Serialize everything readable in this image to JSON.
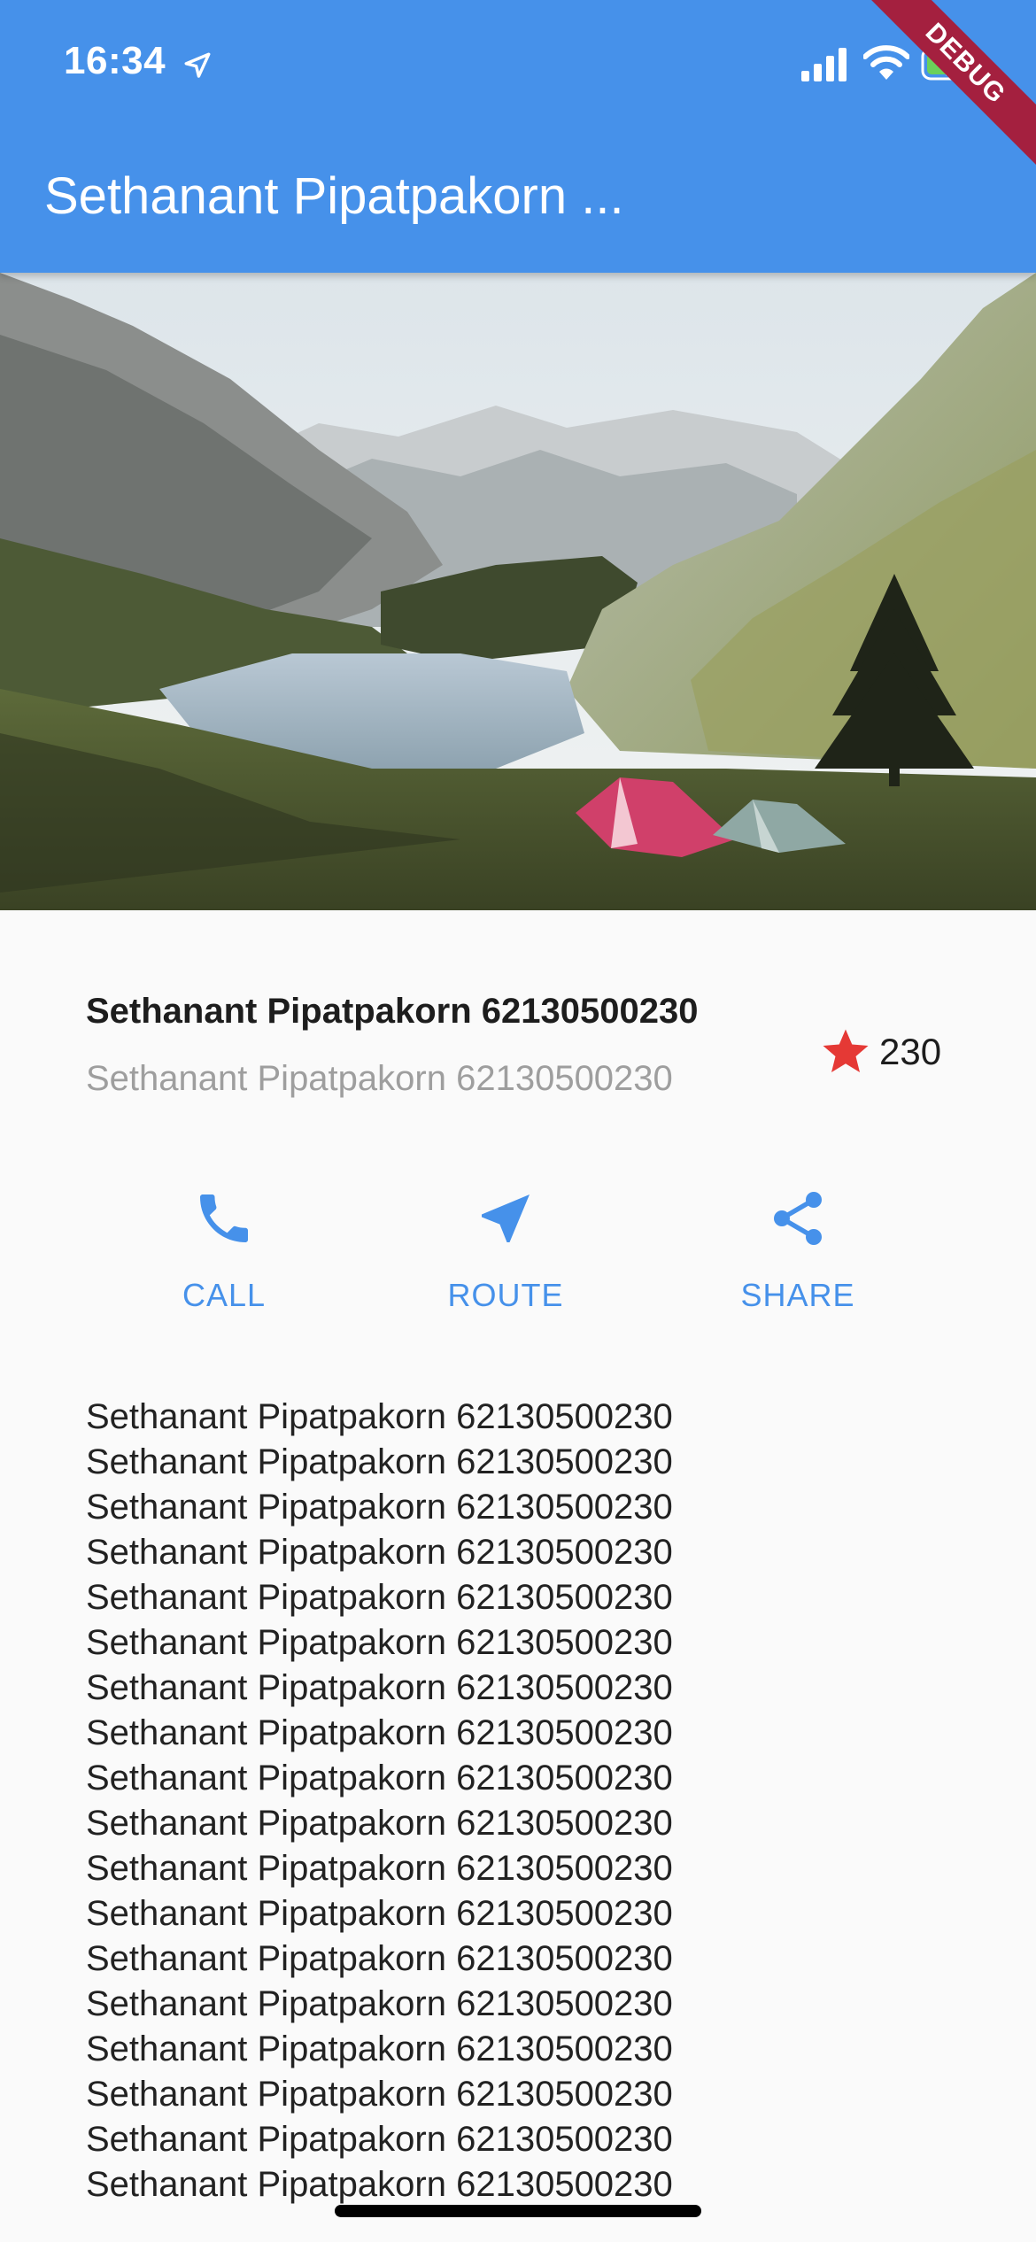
{
  "status_bar": {
    "time": "16:34",
    "icons": [
      "location-arrow-icon",
      "cellular-signal-icon",
      "wifi-icon",
      "battery-charging-icon"
    ]
  },
  "debug_banner": "DEBUG",
  "app_bar": {
    "title": "Sethanant Pipatpakorn ...",
    "background_color": "#4691ea"
  },
  "hero_image": {
    "subject": "mountain-lake-with-tents-photo"
  },
  "title_section": {
    "name": "Sethanant Pipatpakorn 62130500230",
    "subtitle": "Sethanant Pipatpakorn 62130500230",
    "star_icon": "star-icon",
    "star_color": "#e53935",
    "favorite_count": "230"
  },
  "actions": [
    {
      "label": "CALL",
      "icon": "phone-icon"
    },
    {
      "label": "ROUTE",
      "icon": "near-me-icon"
    },
    {
      "label": "SHARE",
      "icon": "share-icon"
    }
  ],
  "accent_color": "#4691ea",
  "description_lines": [
    "Sethanant Pipatpakorn 62130500230",
    "Sethanant Pipatpakorn 62130500230",
    "Sethanant Pipatpakorn 62130500230",
    "Sethanant Pipatpakorn 62130500230",
    "Sethanant Pipatpakorn 62130500230",
    "Sethanant Pipatpakorn 62130500230",
    "Sethanant Pipatpakorn 62130500230",
    "Sethanant Pipatpakorn 62130500230",
    "Sethanant Pipatpakorn 62130500230",
    "Sethanant Pipatpakorn 62130500230",
    "Sethanant Pipatpakorn 62130500230",
    "Sethanant Pipatpakorn 62130500230",
    "Sethanant Pipatpakorn 62130500230",
    "Sethanant Pipatpakorn 62130500230",
    "Sethanant Pipatpakorn 62130500230",
    "Sethanant Pipatpakorn 62130500230",
    "Sethanant Pipatpakorn 62130500230",
    "Sethanant Pipatpakorn 62130500230"
  ]
}
